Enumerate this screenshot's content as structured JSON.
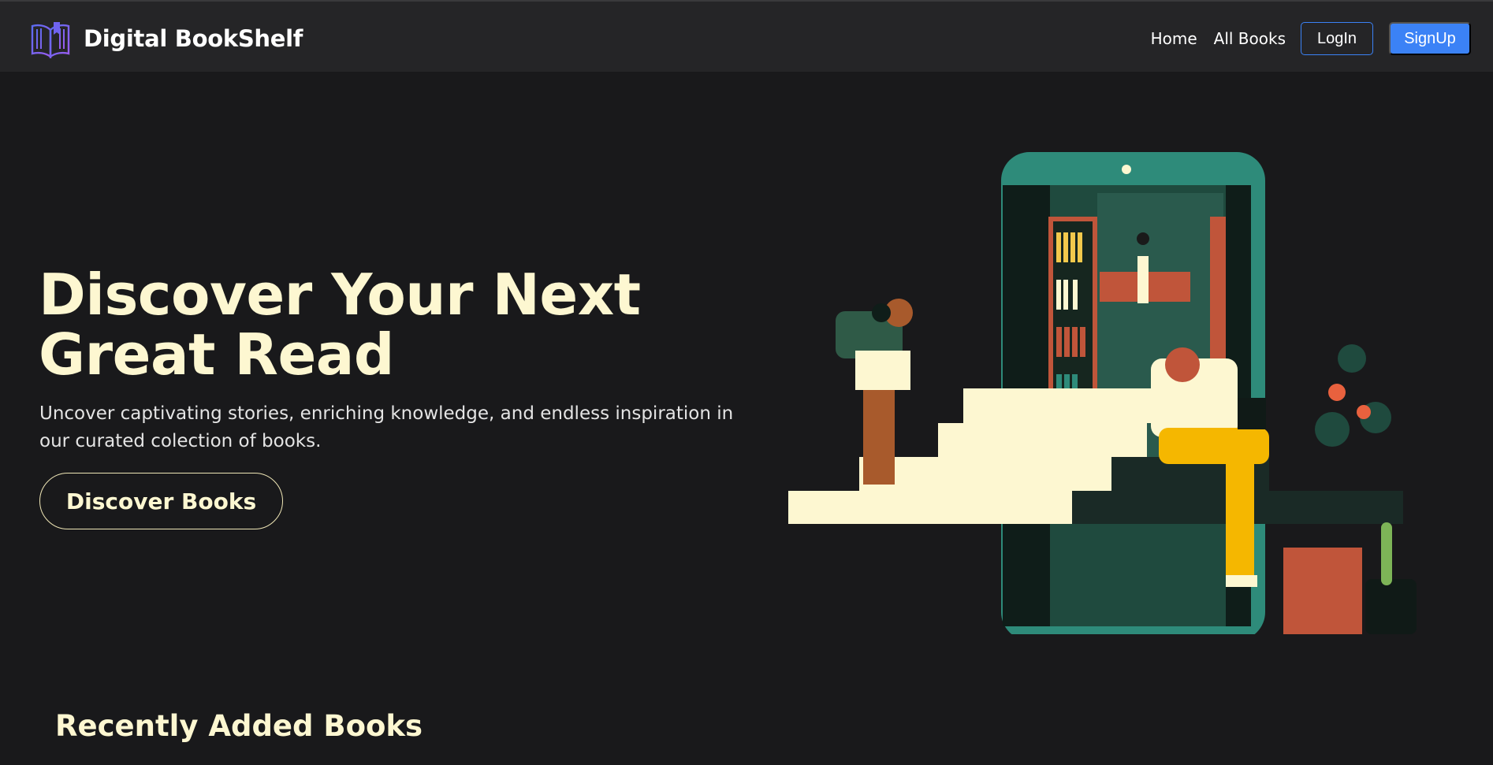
{
  "nav": {
    "brand": "Digital BookShelf",
    "logo_icon": "open-book-icon",
    "links": {
      "home": "Home",
      "all_books": "All Books"
    },
    "login": "LogIn",
    "signup": "SignUp"
  },
  "hero": {
    "title": "Discover Your Next Great Read",
    "subtitle": "Uncover captivating stories, enriching knowledge, and endless inspiration in our curated colection of books.",
    "cta": "Discover Books",
    "illustration": "people-climbing-book-stairs-to-phone-library-illustration"
  },
  "recent": {
    "title": "Recently Added Books"
  },
  "colors": {
    "background": "#19191b",
    "navbar": "#252527",
    "accent_blue": "#3b82f6",
    "cream": "#fdf7d1"
  }
}
